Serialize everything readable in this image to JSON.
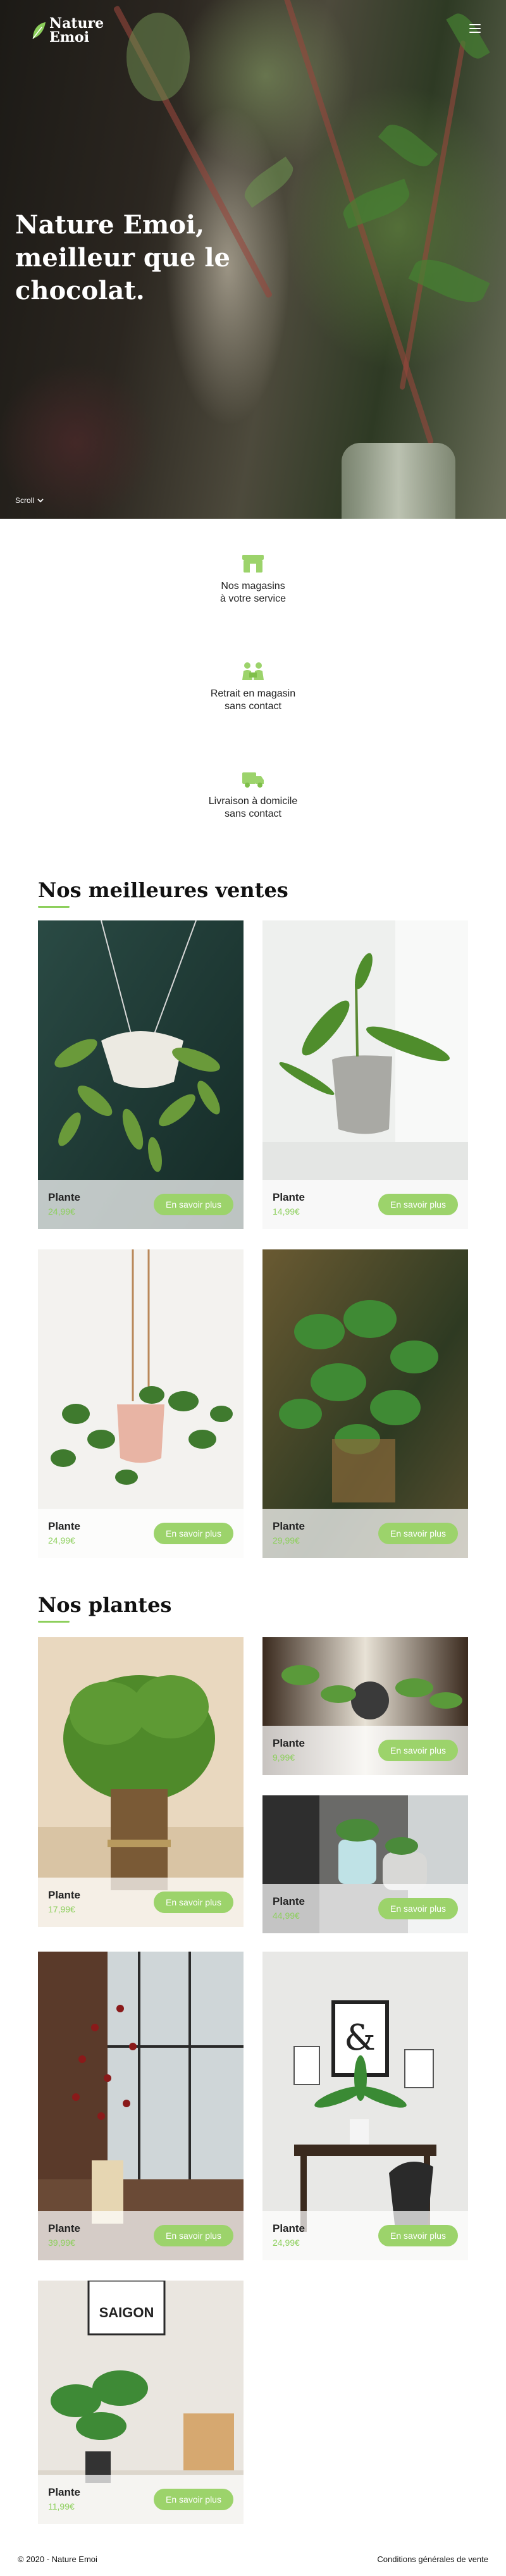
{
  "brand": {
    "name": "Nature Emoi",
    "accent": "#8ccf5b"
  },
  "hero": {
    "title": "Nature Emoi, meilleur que le chocolat.",
    "scroll_label": "Scroll"
  },
  "services": [
    {
      "icon": "store-icon",
      "label": "Nos magasins\nà votre service"
    },
    {
      "icon": "pickup-icon",
      "label": "Retrait en magasin\nsans contact"
    },
    {
      "icon": "truck-icon",
      "label": "Livraison à domicile\nsans contact"
    }
  ],
  "best_sellers": {
    "title": "Nos meilleures ventes",
    "products": [
      {
        "name": "Plante",
        "price": "24,99€",
        "button": "En savoir plus"
      },
      {
        "name": "Plante",
        "price": "14,99€",
        "button": "En savoir plus"
      },
      {
        "name": "Plante",
        "price": "24,99€",
        "button": "En savoir plus"
      },
      {
        "name": "Plante",
        "price": "29,99€",
        "button": "En savoir plus"
      }
    ]
  },
  "plants": {
    "title": "Nos plantes",
    "products": [
      {
        "name": "Plante",
        "price": "17,99€",
        "button": "En savoir plus"
      },
      {
        "name": "Plante",
        "price": "9,99€",
        "button": "En savoir plus"
      },
      {
        "name": "Plante",
        "price": "44,99€",
        "button": "En savoir plus"
      },
      {
        "name": "Plante",
        "price": "39,99€",
        "button": "En savoir plus"
      },
      {
        "name": "Plante",
        "price": "24,99€",
        "button": "En savoir plus"
      },
      {
        "name": "Plante",
        "price": "11,99€",
        "button": "En savoir plus"
      }
    ]
  },
  "footer": {
    "copyright": "© 2020 - Nature Emoi",
    "terms": "Conditions générales de vente"
  }
}
